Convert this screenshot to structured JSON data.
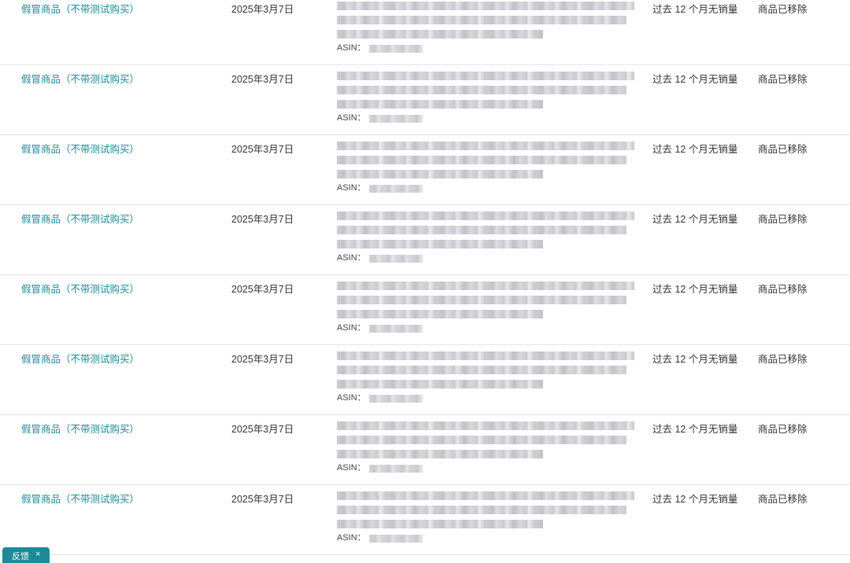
{
  "rows": [
    {
      "reason": "假冒商品（不带测试购买）",
      "date": "2025年3月7日",
      "asin_label": "ASIN：",
      "sales": "过去 12 个月无销量",
      "status": "商品已移除"
    },
    {
      "reason": "假冒商品（不带测试购买）",
      "date": "2025年3月7日",
      "asin_label": "ASIN：",
      "sales": "过去 12 个月无销量",
      "status": "商品已移除"
    },
    {
      "reason": "假冒商品（不带测试购买）",
      "date": "2025年3月7日",
      "asin_label": "ASIN：",
      "sales": "过去 12 个月无销量",
      "status": "商品已移除"
    },
    {
      "reason": "假冒商品（不带测试购买）",
      "date": "2025年3月7日",
      "asin_label": "ASIN：",
      "sales": "过去 12 个月无销量",
      "status": "商品已移除"
    },
    {
      "reason": "假冒商品（不带测试购买）",
      "date": "2025年3月7日",
      "asin_label": "ASIN：",
      "sales": "过去 12 个月无销量",
      "status": "商品已移除"
    },
    {
      "reason": "假冒商品（不带测试购买）",
      "date": "2025年3月7日",
      "asin_label": "ASIN：",
      "sales": "过去 12 个月无销量",
      "status": "商品已移除"
    },
    {
      "reason": "假冒商品（不带测试购买）",
      "date": "2025年3月7日",
      "asin_label": "ASIN：",
      "sales": "过去 12 个月无销量",
      "status": "商品已移除"
    },
    {
      "reason": "假冒商品（不带测试购买）",
      "date": "2025年3月7日",
      "asin_label": "ASIN：",
      "sales": "过去 12 个月无销量",
      "status": "商品已移除"
    }
  ],
  "feedback": {
    "label": "反馈",
    "close_icon": "×"
  },
  "colors": {
    "link": "#1a8a96",
    "feedback_bg": "#1c8a97",
    "row_border": "#e3e3e3"
  }
}
